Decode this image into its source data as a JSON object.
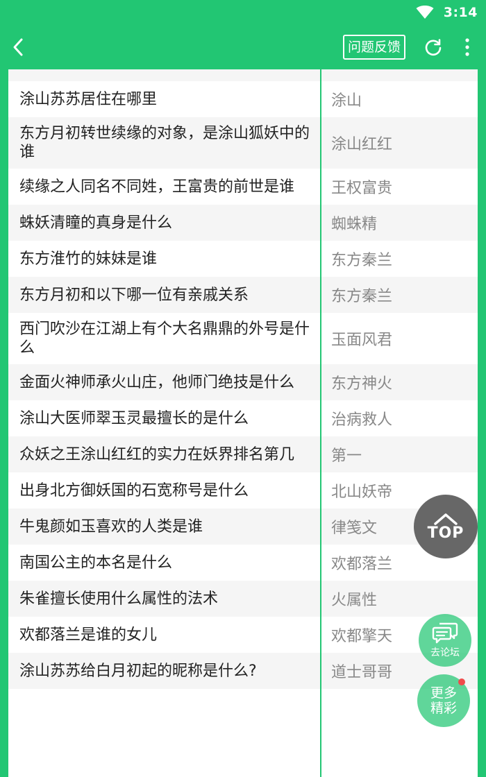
{
  "status_bar": {
    "time": "3:14",
    "wifi_icon": "wifi-icon"
  },
  "toolbar": {
    "back_icon": "chevron-left-icon",
    "feedback_label": "问题反馈",
    "refresh_icon": "refresh-icon",
    "more_icon": "more-vertical-icon",
    "background_color": "#22c673"
  },
  "qa_rows": [
    {
      "question": "涂山苏苏居住在哪里",
      "answer": "涂山"
    },
    {
      "question": "东方月初转世续缘的对象，是涂山狐妖中的谁",
      "answer": "涂山红红"
    },
    {
      "question": "续缘之人同名不同姓，王富贵的前世是谁",
      "answer": "王权富贵"
    },
    {
      "question": "蛛妖清瞳的真身是什么",
      "answer": "蜘蛛精"
    },
    {
      "question": "东方淮竹的妹妹是谁",
      "answer": "东方秦兰"
    },
    {
      "question": "东方月初和以下哪一位有亲戚关系",
      "answer": "东方秦兰"
    },
    {
      "question": "西门吹沙在江湖上有个大名鼎鼎的外号是什么",
      "answer": "玉面风君"
    },
    {
      "question": "金面火神师承火山庄，他师门绝技是什么",
      "answer": "东方神火"
    },
    {
      "question": "涂山大医师翠玉灵最擅长的是什么",
      "answer": "治病救人"
    },
    {
      "question": "众妖之王涂山红红的实力在妖界排名第几",
      "answer": "第一"
    },
    {
      "question": "出身北方御妖国的石宽称号是什么",
      "answer": "北山妖帝"
    },
    {
      "question": "牛鬼颜如玉喜欢的人类是谁",
      "answer": "律笺文"
    },
    {
      "question": "南国公主的本名是什么",
      "answer": "欢都落兰"
    },
    {
      "question": "朱雀擅长使用什么属性的法术",
      "answer": "火属性"
    },
    {
      "question": "欢都落兰是谁的女儿",
      "answer": "欢都擎天"
    },
    {
      "question": "涂山苏苏给白月初起的昵称是什么?",
      "answer": "道士哥哥"
    }
  ],
  "floating": {
    "top_label": "TOP",
    "top_icon": "chevron-up-icon",
    "forum_label": "去论坛",
    "forum_icon": "chat-bubbles-icon",
    "more_line1": "更多",
    "more_line2": "精彩",
    "notification_color": "#f04b4b"
  }
}
